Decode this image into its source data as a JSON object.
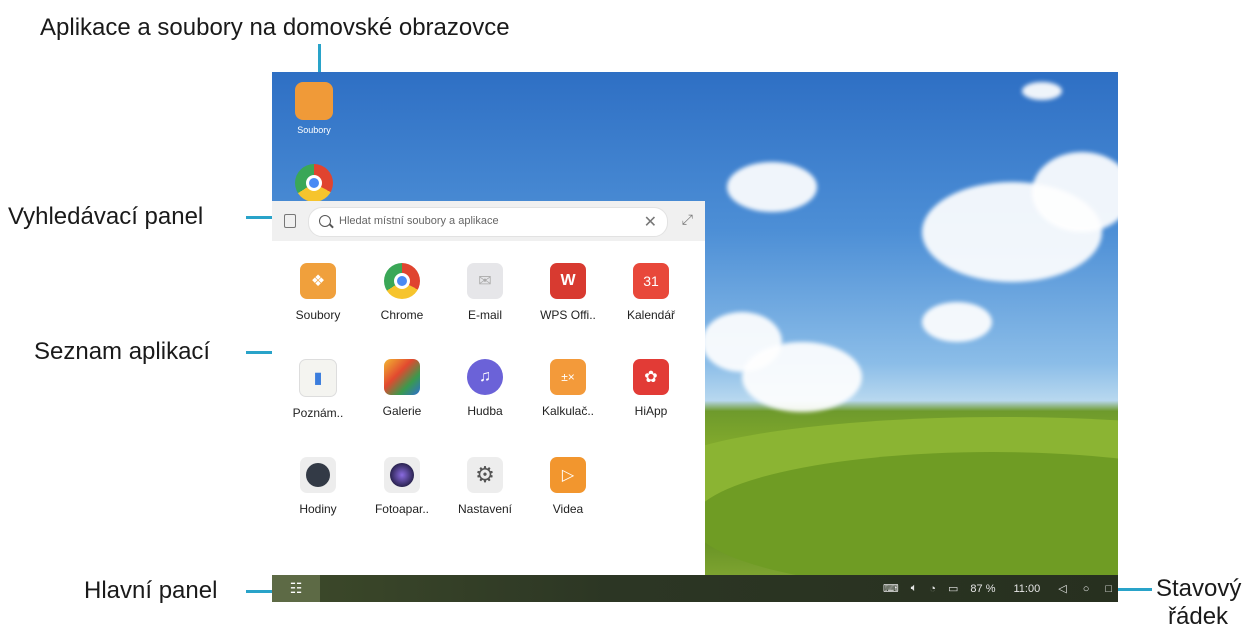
{
  "callouts": {
    "home": "Aplikace a soubory na domovské obrazovce",
    "search": "Vyhledávací panel",
    "apps": "Seznam aplikací",
    "taskbar": "Hlavní panel",
    "status_line1": "Stavový",
    "status_line2": "řádek"
  },
  "desktop": {
    "files_label": "Soubory"
  },
  "search": {
    "placeholder": "Hledat místní soubory a aplikace"
  },
  "apps": [
    {
      "label": "Soubory",
      "icon": "folder-icon",
      "color": "#f0a03c"
    },
    {
      "label": "Chrome",
      "icon": "chrome-icon",
      "color": "#ffffff"
    },
    {
      "label": "E-mail",
      "icon": "mail-icon",
      "color": "#e8e8ea"
    },
    {
      "label": "WPS Offi..",
      "icon": "wps-icon",
      "color": "#d83a30"
    },
    {
      "label": "Kalendář",
      "icon": "calendar-icon",
      "color": "#e8483a",
      "glyph": "31"
    },
    {
      "label": "Poznám..",
      "icon": "notes-icon",
      "color": "#f4f4f0"
    },
    {
      "label": "Galerie",
      "icon": "gallery-icon",
      "color": "#ececec"
    },
    {
      "label": "Hudba",
      "icon": "music-icon",
      "color": "#6b62d8"
    },
    {
      "label": "Kalkulač..",
      "icon": "calculator-icon",
      "color": "#f39a3a"
    },
    {
      "label": "HiApp",
      "icon": "hiapp-icon",
      "color": "#e23b36"
    },
    {
      "label": "Hodiny",
      "icon": "clock-icon",
      "color": "#ededed"
    },
    {
      "label": "Fotoapar..",
      "icon": "camera-icon",
      "color": "#ededed"
    },
    {
      "label": "Nastavení",
      "icon": "settings-icon",
      "color": "#ededed"
    },
    {
      "label": "Videa",
      "icon": "video-icon",
      "color": "#f2962e"
    }
  ],
  "status": {
    "battery": "87 %",
    "time": "11:00"
  }
}
